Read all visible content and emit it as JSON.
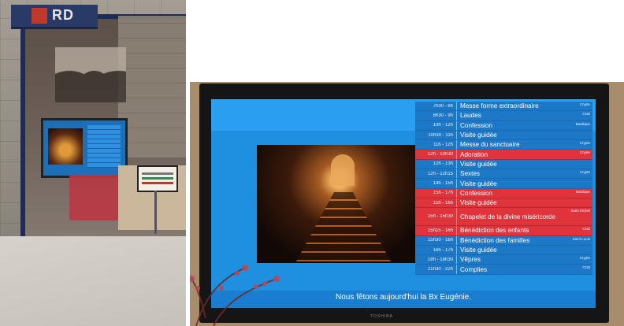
{
  "left_photo": {
    "shop_sign_text": "RD"
  },
  "right_photo": {
    "tv_brand": "TOSHIBA",
    "schedule": [
      {
        "time": "7h30 - 8h",
        "event": "Messe forme extraordinaire",
        "place": "Crypte",
        "highlight": false
      },
      {
        "time": "8h30 - 9h",
        "event": "Laudes",
        "place": "CND",
        "highlight": false
      },
      {
        "time": "10h - 12h",
        "event": "Confession",
        "place": "Basilique",
        "highlight": false
      },
      {
        "time": "10h30 - 11h",
        "event": "Visite guidée",
        "place": "",
        "highlight": false
      },
      {
        "time": "11h - 12h",
        "event": "Messe du sanctuaire",
        "place": "Crypte",
        "highlight": false
      },
      {
        "time": "12h - 10h30",
        "event": "Adoration",
        "place": "Crypte",
        "highlight": true
      },
      {
        "time": "12h - 13h",
        "event": "Visite guidée",
        "place": "",
        "highlight": false
      },
      {
        "time": "12h - 12h15",
        "event": "Sextes",
        "place": "Crypte",
        "highlight": false
      },
      {
        "time": "14h - 15h",
        "event": "Visite guidée",
        "place": "",
        "highlight": false
      },
      {
        "time": "15h - 17h",
        "event": "Confession",
        "place": "Basilique",
        "highlight": true
      },
      {
        "time": "15h - 16h",
        "event": "Visite guidée",
        "place": "",
        "highlight": true
      },
      {
        "time": "15h - 15h30",
        "event": "Chapelet de la divine miséricorde",
        "place": "Saint Michel",
        "highlight": true,
        "tall": true
      },
      {
        "time": "15h15 - 16h",
        "event": "Bénédiction des enfants",
        "place": "CND",
        "highlight": true
      },
      {
        "time": "15h30 - 16h",
        "event": "Bénédiction des familles",
        "place": "Saint Louis",
        "highlight": false
      },
      {
        "time": "16h - 17h",
        "event": "Visite guidée",
        "place": "",
        "highlight": false
      },
      {
        "time": "18h - 18h30",
        "event": "Vêpres",
        "place": "Crypte",
        "highlight": false
      },
      {
        "time": "21h30 - 22h",
        "event": "Complies",
        "place": "CND",
        "highlight": false
      }
    ],
    "ticker": "Nous fêtons aujourd'hui la Bx Eugénie."
  },
  "colors": {
    "screen_blue": "#1f8fe0",
    "highlight_red": "#e0343c",
    "frame_navy": "#1e2b57"
  }
}
